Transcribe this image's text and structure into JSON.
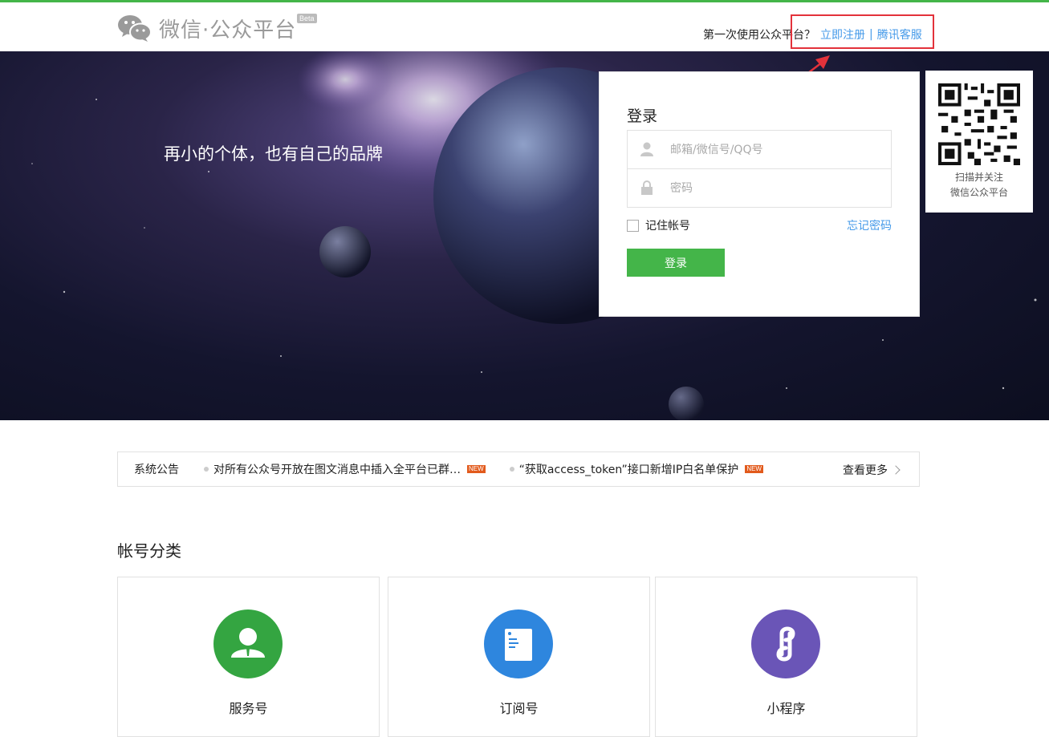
{
  "header": {
    "logo_text": "微信·公众平台",
    "beta": "Beta",
    "first_time": "第一次使用公众平台？",
    "register": "立即注册",
    "separator": "|",
    "support": "腾讯客服"
  },
  "banner": {
    "slogan": "再小的个体，也有自己的品牌"
  },
  "login": {
    "title": "登录",
    "account_placeholder": "邮箱/微信号/QQ号",
    "password_placeholder": "密码",
    "remember": "记住帐号",
    "forgot": "忘记密码",
    "submit": "登录"
  },
  "qr": {
    "line1": "扫描并关注",
    "line2": "微信公众平台"
  },
  "notice": {
    "label": "系统公告",
    "items": [
      {
        "text": "对所有公众号开放在图文消息中插入全平台已群…",
        "badge": "NEW"
      },
      {
        "text": "“获取access_token”接口新增IP白名单保护",
        "badge": "NEW"
      }
    ],
    "more": "查看更多"
  },
  "accounts": {
    "title": "帐号分类",
    "cards": [
      {
        "label": "服务号",
        "color": "#34a541",
        "icon": "person-icon"
      },
      {
        "label": "订阅号",
        "color": "#2e86de",
        "icon": "document-icon"
      },
      {
        "label": "小程序",
        "color": "#6a55b7",
        "icon": "mini-program-icon"
      }
    ]
  },
  "colors": {
    "brand_green": "#44b549",
    "link_blue": "#459ae9",
    "annotation_red": "#e3323b"
  }
}
